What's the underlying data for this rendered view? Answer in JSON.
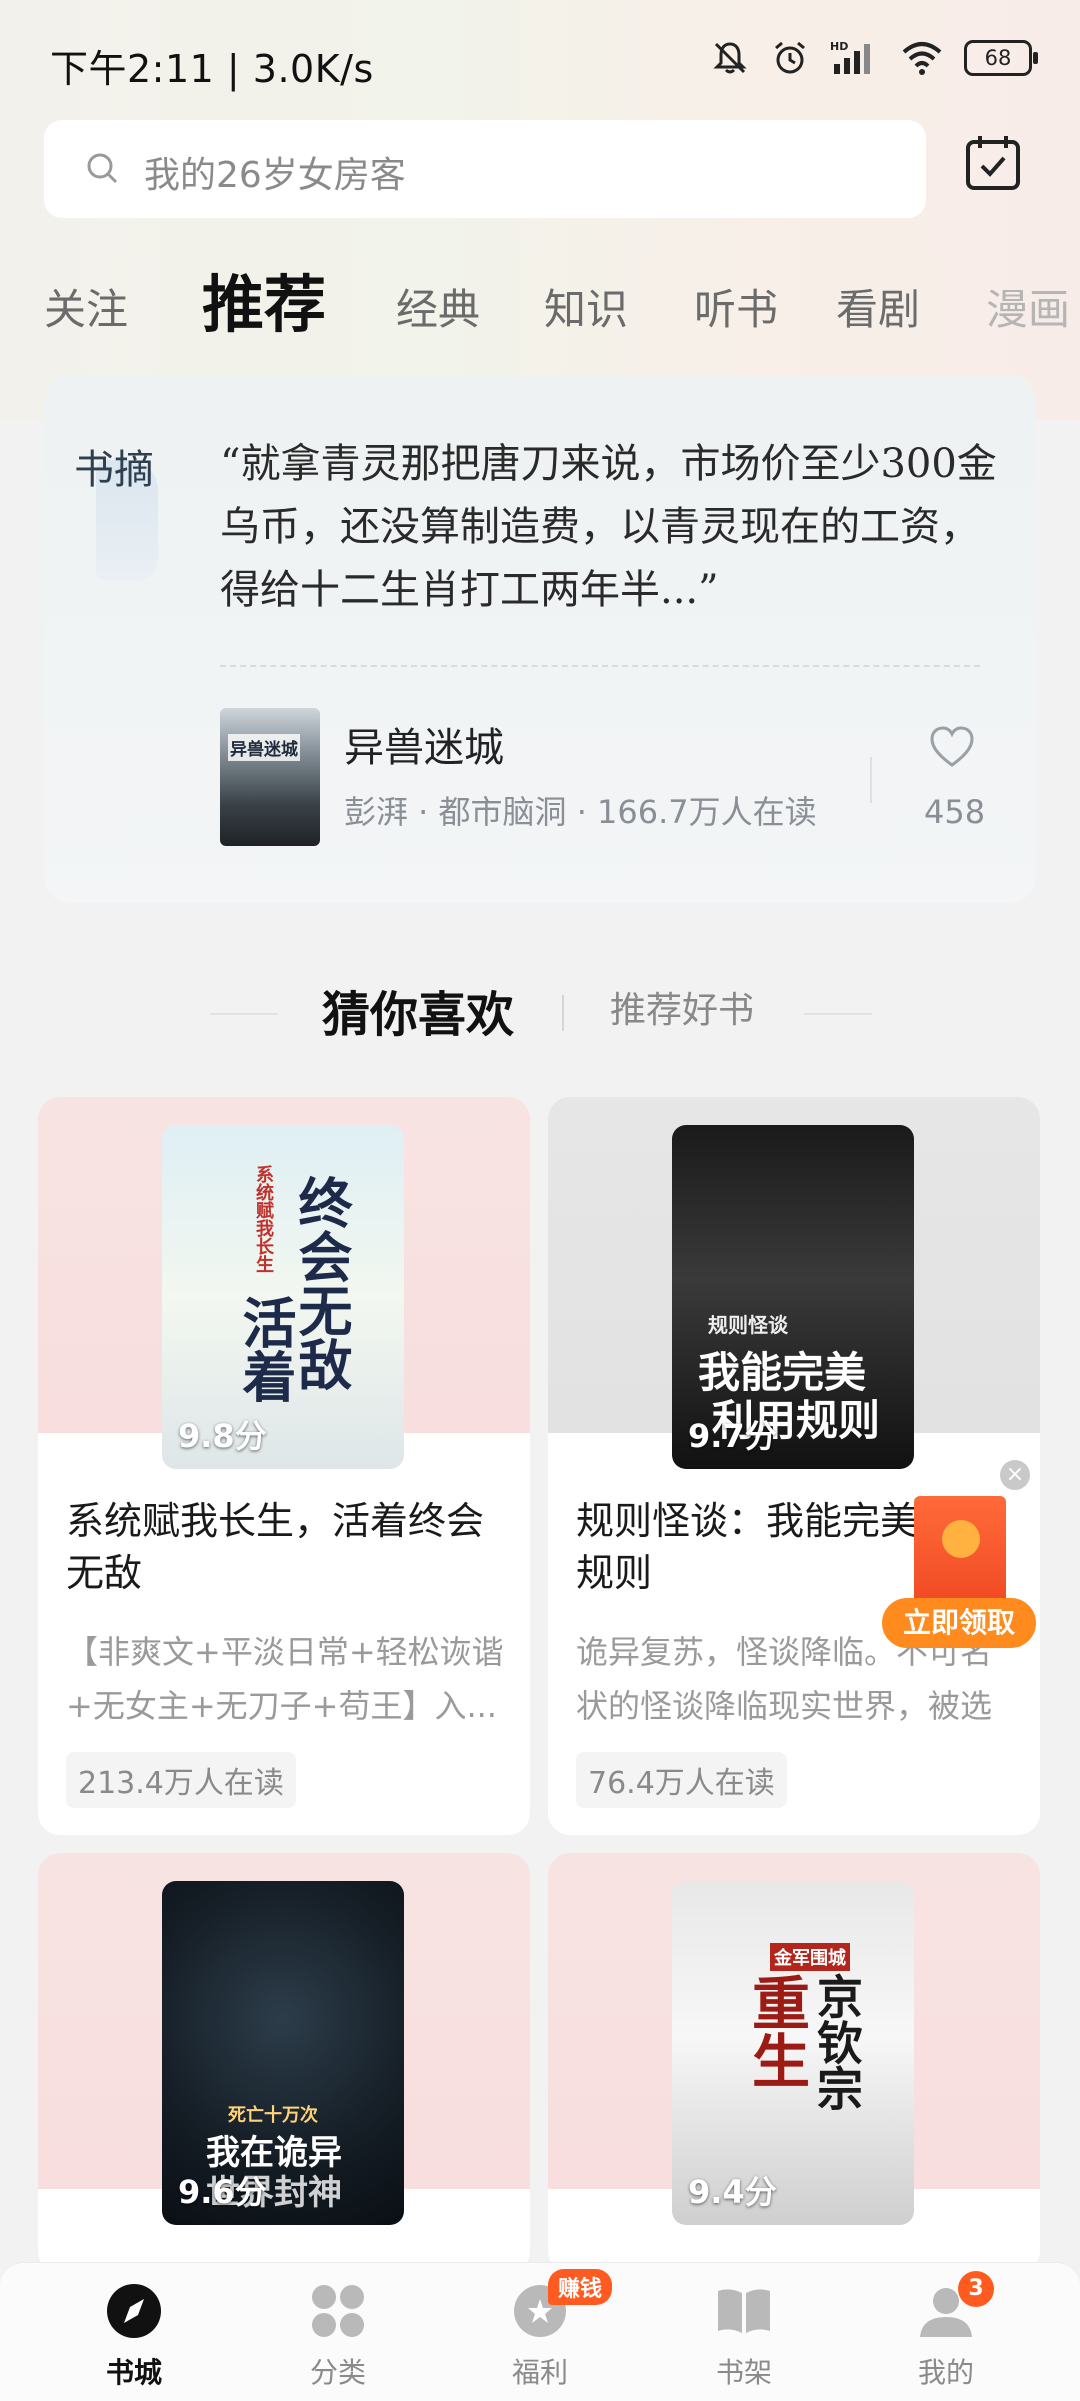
{
  "status_bar": {
    "time": "下午2:11 | 3.0K/s",
    "battery": "68"
  },
  "search": {
    "placeholder": "我的26岁女房客"
  },
  "tabs": [
    {
      "label": "关注"
    },
    {
      "label": "推荐"
    },
    {
      "label": "经典"
    },
    {
      "label": "知识"
    },
    {
      "label": "听书"
    },
    {
      "label": "看剧"
    },
    {
      "label": "漫画"
    }
  ],
  "excerpt": {
    "label": "书摘",
    "quote": "“就拿青灵那把唐刀来说，市场价至少300金乌币，还没算制造费，以青灵现在的工资，得给十二生肖打工两年半...”",
    "book_cover_text": "异兽迷城",
    "book_title": "异兽迷城",
    "book_meta": "彭湃 · 都市脑洞 · 166.7万人在读",
    "likes": "458"
  },
  "section": {
    "title": "猜你喜欢",
    "subtitle": "推荐好书"
  },
  "books": [
    {
      "score": "9.8分",
      "title": "系统赋我长生，活着终会无敌",
      "desc": "【非爽文+平淡日常+轻松诙谐+无女主+无刀子+苟王】入...",
      "reads": "213.4万人在读",
      "cover_line1": "终会无敌",
      "cover_line2": "活着",
      "cover_small": "系统赋我长生"
    },
    {
      "score": "9.7分",
      "title": "规则怪谈：我能完美利用规则",
      "desc": "诡异复苏，怪谈降临。不可名状的怪谈降临现实世界，被选召的...",
      "reads": "76.4万人在读",
      "cover_line1": "我能完美",
      "cover_line2": "利用规则",
      "cover_small": "规则怪谈"
    },
    {
      "score": "9.6分",
      "cover_line1": "我在诡异",
      "cover_line2": "世界封神",
      "cover_small": "死亡十万次"
    },
    {
      "score": "9.4分",
      "cover_line1": "重生",
      "cover_line2": "京钦宗",
      "cover_small": "金军围城"
    }
  ],
  "redpacket": {
    "label": "立即领取",
    "close": "×"
  },
  "bottom_nav": [
    {
      "label": "书城",
      "icon": "compass-icon"
    },
    {
      "label": "分类",
      "icon": "grid-icon"
    },
    {
      "label": "福利",
      "icon": "gift-icon",
      "badge": "赚钱"
    },
    {
      "label": "书架",
      "icon": "book-icon"
    },
    {
      "label": "我的",
      "icon": "profile-icon",
      "badge": "3"
    }
  ],
  "colors": {
    "accent": "#ff5a1f",
    "text": "#222222"
  }
}
